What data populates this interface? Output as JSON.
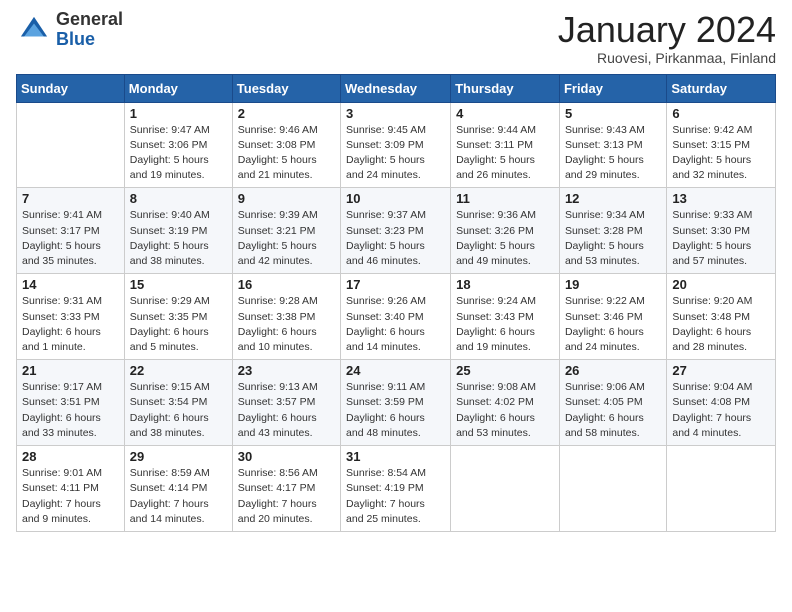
{
  "header": {
    "logo_general": "General",
    "logo_blue": "Blue",
    "month_title": "January 2024",
    "subtitle": "Ruovesi, Pirkanmaa, Finland"
  },
  "weekdays": [
    "Sunday",
    "Monday",
    "Tuesday",
    "Wednesday",
    "Thursday",
    "Friday",
    "Saturday"
  ],
  "weeks": [
    [
      {
        "day": "",
        "info": ""
      },
      {
        "day": "1",
        "info": "Sunrise: 9:47 AM\nSunset: 3:06 PM\nDaylight: 5 hours\nand 19 minutes."
      },
      {
        "day": "2",
        "info": "Sunrise: 9:46 AM\nSunset: 3:08 PM\nDaylight: 5 hours\nand 21 minutes."
      },
      {
        "day": "3",
        "info": "Sunrise: 9:45 AM\nSunset: 3:09 PM\nDaylight: 5 hours\nand 24 minutes."
      },
      {
        "day": "4",
        "info": "Sunrise: 9:44 AM\nSunset: 3:11 PM\nDaylight: 5 hours\nand 26 minutes."
      },
      {
        "day": "5",
        "info": "Sunrise: 9:43 AM\nSunset: 3:13 PM\nDaylight: 5 hours\nand 29 minutes."
      },
      {
        "day": "6",
        "info": "Sunrise: 9:42 AM\nSunset: 3:15 PM\nDaylight: 5 hours\nand 32 minutes."
      }
    ],
    [
      {
        "day": "7",
        "info": "Sunrise: 9:41 AM\nSunset: 3:17 PM\nDaylight: 5 hours\nand 35 minutes."
      },
      {
        "day": "8",
        "info": "Sunrise: 9:40 AM\nSunset: 3:19 PM\nDaylight: 5 hours\nand 38 minutes."
      },
      {
        "day": "9",
        "info": "Sunrise: 9:39 AM\nSunset: 3:21 PM\nDaylight: 5 hours\nand 42 minutes."
      },
      {
        "day": "10",
        "info": "Sunrise: 9:37 AM\nSunset: 3:23 PM\nDaylight: 5 hours\nand 46 minutes."
      },
      {
        "day": "11",
        "info": "Sunrise: 9:36 AM\nSunset: 3:26 PM\nDaylight: 5 hours\nand 49 minutes."
      },
      {
        "day": "12",
        "info": "Sunrise: 9:34 AM\nSunset: 3:28 PM\nDaylight: 5 hours\nand 53 minutes."
      },
      {
        "day": "13",
        "info": "Sunrise: 9:33 AM\nSunset: 3:30 PM\nDaylight: 5 hours\nand 57 minutes."
      }
    ],
    [
      {
        "day": "14",
        "info": "Sunrise: 9:31 AM\nSunset: 3:33 PM\nDaylight: 6 hours\nand 1 minute."
      },
      {
        "day": "15",
        "info": "Sunrise: 9:29 AM\nSunset: 3:35 PM\nDaylight: 6 hours\nand 5 minutes."
      },
      {
        "day": "16",
        "info": "Sunrise: 9:28 AM\nSunset: 3:38 PM\nDaylight: 6 hours\nand 10 minutes."
      },
      {
        "day": "17",
        "info": "Sunrise: 9:26 AM\nSunset: 3:40 PM\nDaylight: 6 hours\nand 14 minutes."
      },
      {
        "day": "18",
        "info": "Sunrise: 9:24 AM\nSunset: 3:43 PM\nDaylight: 6 hours\nand 19 minutes."
      },
      {
        "day": "19",
        "info": "Sunrise: 9:22 AM\nSunset: 3:46 PM\nDaylight: 6 hours\nand 24 minutes."
      },
      {
        "day": "20",
        "info": "Sunrise: 9:20 AM\nSunset: 3:48 PM\nDaylight: 6 hours\nand 28 minutes."
      }
    ],
    [
      {
        "day": "21",
        "info": "Sunrise: 9:17 AM\nSunset: 3:51 PM\nDaylight: 6 hours\nand 33 minutes."
      },
      {
        "day": "22",
        "info": "Sunrise: 9:15 AM\nSunset: 3:54 PM\nDaylight: 6 hours\nand 38 minutes."
      },
      {
        "day": "23",
        "info": "Sunrise: 9:13 AM\nSunset: 3:57 PM\nDaylight: 6 hours\nand 43 minutes."
      },
      {
        "day": "24",
        "info": "Sunrise: 9:11 AM\nSunset: 3:59 PM\nDaylight: 6 hours\nand 48 minutes."
      },
      {
        "day": "25",
        "info": "Sunrise: 9:08 AM\nSunset: 4:02 PM\nDaylight: 6 hours\nand 53 minutes."
      },
      {
        "day": "26",
        "info": "Sunrise: 9:06 AM\nSunset: 4:05 PM\nDaylight: 6 hours\nand 58 minutes."
      },
      {
        "day": "27",
        "info": "Sunrise: 9:04 AM\nSunset: 4:08 PM\nDaylight: 7 hours\nand 4 minutes."
      }
    ],
    [
      {
        "day": "28",
        "info": "Sunrise: 9:01 AM\nSunset: 4:11 PM\nDaylight: 7 hours\nand 9 minutes."
      },
      {
        "day": "29",
        "info": "Sunrise: 8:59 AM\nSunset: 4:14 PM\nDaylight: 7 hours\nand 14 minutes."
      },
      {
        "day": "30",
        "info": "Sunrise: 8:56 AM\nSunset: 4:17 PM\nDaylight: 7 hours\nand 20 minutes."
      },
      {
        "day": "31",
        "info": "Sunrise: 8:54 AM\nSunset: 4:19 PM\nDaylight: 7 hours\nand 25 minutes."
      },
      {
        "day": "",
        "info": ""
      },
      {
        "day": "",
        "info": ""
      },
      {
        "day": "",
        "info": ""
      }
    ]
  ]
}
